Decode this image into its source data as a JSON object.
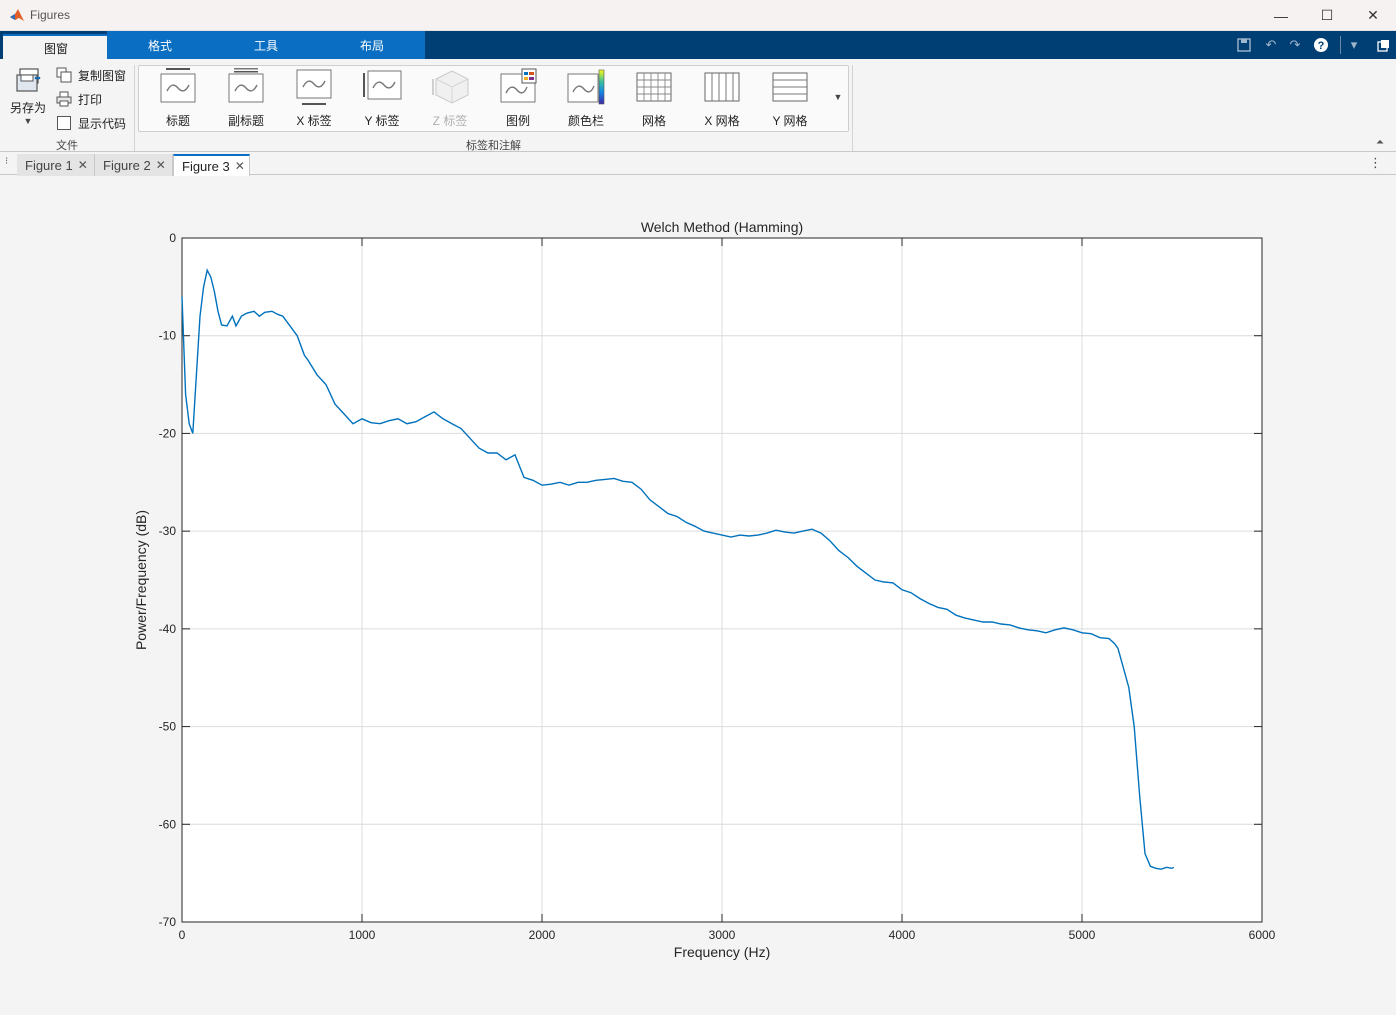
{
  "window": {
    "title": "Figures"
  },
  "ribbon": {
    "tabs": [
      {
        "label": "图窗",
        "active": true
      },
      {
        "label": "格式",
        "active": false
      },
      {
        "label": "工具",
        "active": false
      },
      {
        "label": "布局",
        "active": false
      }
    ],
    "file_group": {
      "label": "文件",
      "save_as": "另存为",
      "copy_figure": "复制图窗",
      "print": "打印",
      "show_code": "显示代码"
    },
    "labels_group": {
      "label": "标签和注解",
      "buttons": [
        "标题",
        "副标题",
        "X 标签",
        "Y 标签",
        "Z 标签",
        "图例",
        "颜色栏",
        "网格",
        "X 网格",
        "Y 网格"
      ]
    }
  },
  "figure_tabs": [
    {
      "label": "Figure 1",
      "active": false
    },
    {
      "label": "Figure 2",
      "active": false
    },
    {
      "label": "Figure 3",
      "active": true
    }
  ],
  "chart_data": {
    "type": "line",
    "title": "Welch Method (Hamming)",
    "xlabel": "Frequency (Hz)",
    "ylabel": "Power/Frequency (dB)",
    "xlim": [
      0,
      6000
    ],
    "ylim": [
      -70,
      0
    ],
    "xticks": [
      "0",
      "1000",
      "2000",
      "3000",
      "4000",
      "5000",
      "6000"
    ],
    "yticks": [
      "0",
      "-10",
      "-20",
      "-30",
      "-40",
      "-50",
      "-60",
      "-70"
    ],
    "grid": true,
    "line_color": "#0072BD",
    "series": [
      {
        "x": [
          0,
          20,
          40,
          60,
          80,
          100,
          120,
          140,
          160,
          180,
          200,
          220,
          250,
          280,
          300,
          330,
          360,
          400,
          430,
          460,
          500,
          530,
          560,
          600,
          640,
          680,
          700,
          750,
          800,
          850,
          900,
          950,
          1000,
          1050,
          1100,
          1150,
          1200,
          1250,
          1300,
          1350,
          1400,
          1450,
          1500,
          1550,
          1600,
          1650,
          1700,
          1750,
          1800,
          1850,
          1900,
          1950,
          2000,
          2050,
          2100,
          2150,
          2200,
          2250,
          2300,
          2350,
          2400,
          2450,
          2500,
          2550,
          2600,
          2650,
          2700,
          2750,
          2800,
          2850,
          2900,
          2950,
          3000,
          3050,
          3100,
          3150,
          3200,
          3250,
          3300,
          3350,
          3400,
          3450,
          3500,
          3550,
          3600,
          3650,
          3700,
          3750,
          3800,
          3850,
          3900,
          3950,
          4000,
          4050,
          4100,
          4150,
          4200,
          4250,
          4300,
          4350,
          4400,
          4450,
          4500,
          4550,
          4600,
          4650,
          4700,
          4750,
          4800,
          4850,
          4900,
          4950,
          5000,
          5050,
          5100,
          5150,
          5180,
          5200,
          5230,
          5260,
          5290,
          5320,
          5350,
          5380,
          5410,
          5440,
          5470,
          5500,
          5510
        ],
        "y": [
          -6,
          -16,
          -19,
          -20,
          -14,
          -8,
          -5,
          -3.3,
          -4,
          -5.5,
          -7.5,
          -8.9,
          -9,
          -8,
          -9,
          -8,
          -7.7,
          -7.5,
          -8,
          -7.6,
          -7.5,
          -7.8,
          -8,
          -9,
          -10,
          -12,
          -12.5,
          -14,
          -15,
          -17,
          -18,
          -19,
          -18.5,
          -18.9,
          -19,
          -18.7,
          -18.5,
          -19,
          -18.8,
          -18.3,
          -17.8,
          -18.5,
          -19,
          -19.5,
          -20.5,
          -21.5,
          -22,
          -22,
          -22.7,
          -22.2,
          -24.5,
          -24.8,
          -25.3,
          -25.2,
          -25,
          -25.3,
          -25,
          -25,
          -24.8,
          -24.7,
          -24.6,
          -24.9,
          -25,
          -25.7,
          -26.8,
          -27.5,
          -28.2,
          -28.5,
          -29.1,
          -29.5,
          -30,
          -30.2,
          -30.4,
          -30.6,
          -30.4,
          -30.5,
          -30.4,
          -30.2,
          -29.9,
          -30.1,
          -30.2,
          -30,
          -29.8,
          -30.2,
          -31,
          -32,
          -32.7,
          -33.6,
          -34.3,
          -35,
          -35.2,
          -35.3,
          -36,
          -36.3,
          -36.9,
          -37.4,
          -37.8,
          -38,
          -38.6,
          -38.9,
          -39.1,
          -39.3,
          -39.3,
          -39.5,
          -39.6,
          -39.9,
          -40.1,
          -40.2,
          -40.4,
          -40.1,
          -39.9,
          -40.1,
          -40.4,
          -40.5,
          -40.9,
          -41,
          -41.5,
          -42,
          -44,
          -46,
          -50,
          -57,
          -63,
          -64.3,
          -64.5,
          -64.6,
          -64.4,
          -64.5,
          -64.4
        ]
      }
    ]
  }
}
